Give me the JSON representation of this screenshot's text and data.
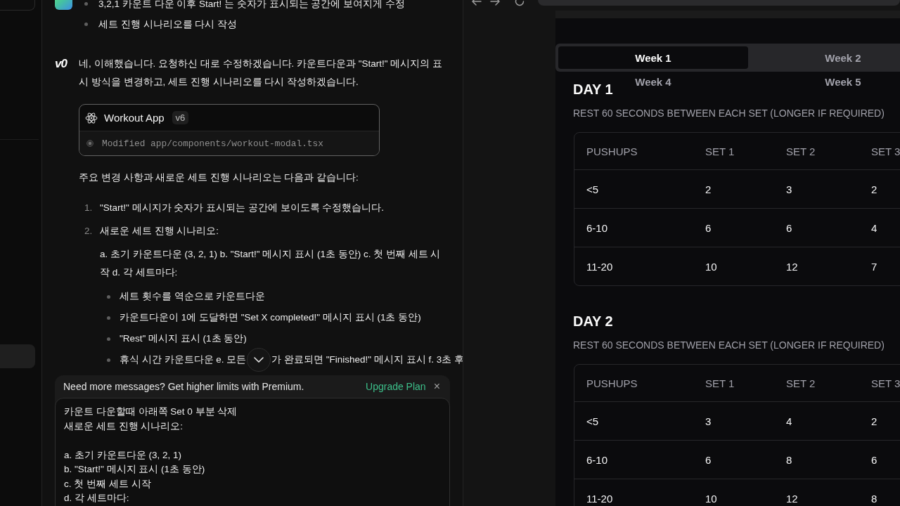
{
  "sidebar": {
    "items": [
      {
        "selected": true
      }
    ]
  },
  "chat": {
    "messages": [
      {
        "kind": "user",
        "bullets": [
          "3,2,1 카운트 다운 이후 Start! 는 숫자가 표시되는 공간에 보여지게 수정",
          "세트 진행 시나리오를 다시 작성"
        ]
      },
      {
        "kind": "assistant",
        "logo": "v0",
        "intro": "네, 이해했습니다. 요청하신 대로 수정하겠습니다. 카운트다운과 \"Start!\" 메시지의 표시 방식을 변경하고, 세트 진행 시나리오를 다시 작성하겠습니다.",
        "artifact": {
          "title": "Workout App",
          "version": "v6",
          "change": "Modified app/components/workout-modal.tsx"
        },
        "summary": "주요 변경 사항과 새로운 세트 진행 시나리오는 다음과 같습니다:",
        "steps": [
          {
            "number": "1.",
            "text": "\"Start!\" 메시지가 숫자가 표시되는 공간에 보이도록 수정했습니다."
          },
          {
            "number": "2.",
            "text": "새로운 세트 진행 시나리오:",
            "details": "a. 초기 카운트다운 (3, 2, 1) b. \"Start!\" 메시지 표시 (1초 동안) c. 첫 번째 세트 시작 d. 각 세트마다:",
            "bullets": [
              [
                "세트 횟수를 역순으로 카운트다운"
              ],
              [
                "카운트다운이 1에 도달하면 \"Set X completed!\" 메시지 표시 (1초 동안)"
              ],
              [
                "\"Rest\" 메시지 표시 (1초 동안)"
              ],
              [
                "휴식 시간 카운트다운 e. 모든",
                "가 완료되면 \"Finished!\" 메시지 표시 f. 3초 후"
              ]
            ]
          }
        ]
      }
    ]
  },
  "composer": {
    "banner": {
      "message": "Need more messages? Get higher limits with Premium.",
      "action": "Upgrade Plan",
      "close": "×"
    },
    "input": {
      "value": "카운트 다운할때 아래쪽 Set 0 부분 삭제\n새로운 세트 진행 시나리오:\n\na. 초기 카운트다운 (3, 2, 1)\nb. \"Start!\" 메시지 표시 (1초 동안)\nc. 첫 번째 세트 시작\nd. 각 세트마다:"
    }
  },
  "preview": {
    "tabs": [
      {
        "label": "Week 1",
        "selected": true
      },
      {
        "label": "Week 2",
        "selected": false
      },
      {
        "label": "Week 4",
        "selected": false
      },
      {
        "label": "Week 5",
        "selected": false
      }
    ],
    "days": [
      {
        "title": "DAY 1",
        "note": "REST 60 SECONDS BETWEEN EACH SET (LONGER IF REQUIRED)",
        "table": {
          "columns": [
            "PUSHUPS",
            "SET 1",
            "SET 2",
            "SET 3"
          ],
          "rows": [
            [
              "<5",
              "2",
              "3",
              "2"
            ],
            [
              "6-10",
              "6",
              "6",
              "4"
            ],
            [
              "11-20",
              "10",
              "12",
              "7"
            ]
          ]
        }
      },
      {
        "title": "DAY 2",
        "note": "REST 60 SECONDS BETWEEN EACH SET (LONGER IF REQUIRED)",
        "table": {
          "columns": [
            "PUSHUPS",
            "SET 1",
            "SET 2",
            "SET 3"
          ],
          "rows": [
            [
              "<5",
              "3",
              "4",
              "2"
            ],
            [
              "6-10",
              "6",
              "8",
              "6"
            ],
            [
              "11-20",
              "10",
              "12",
              "8"
            ]
          ]
        }
      }
    ]
  }
}
